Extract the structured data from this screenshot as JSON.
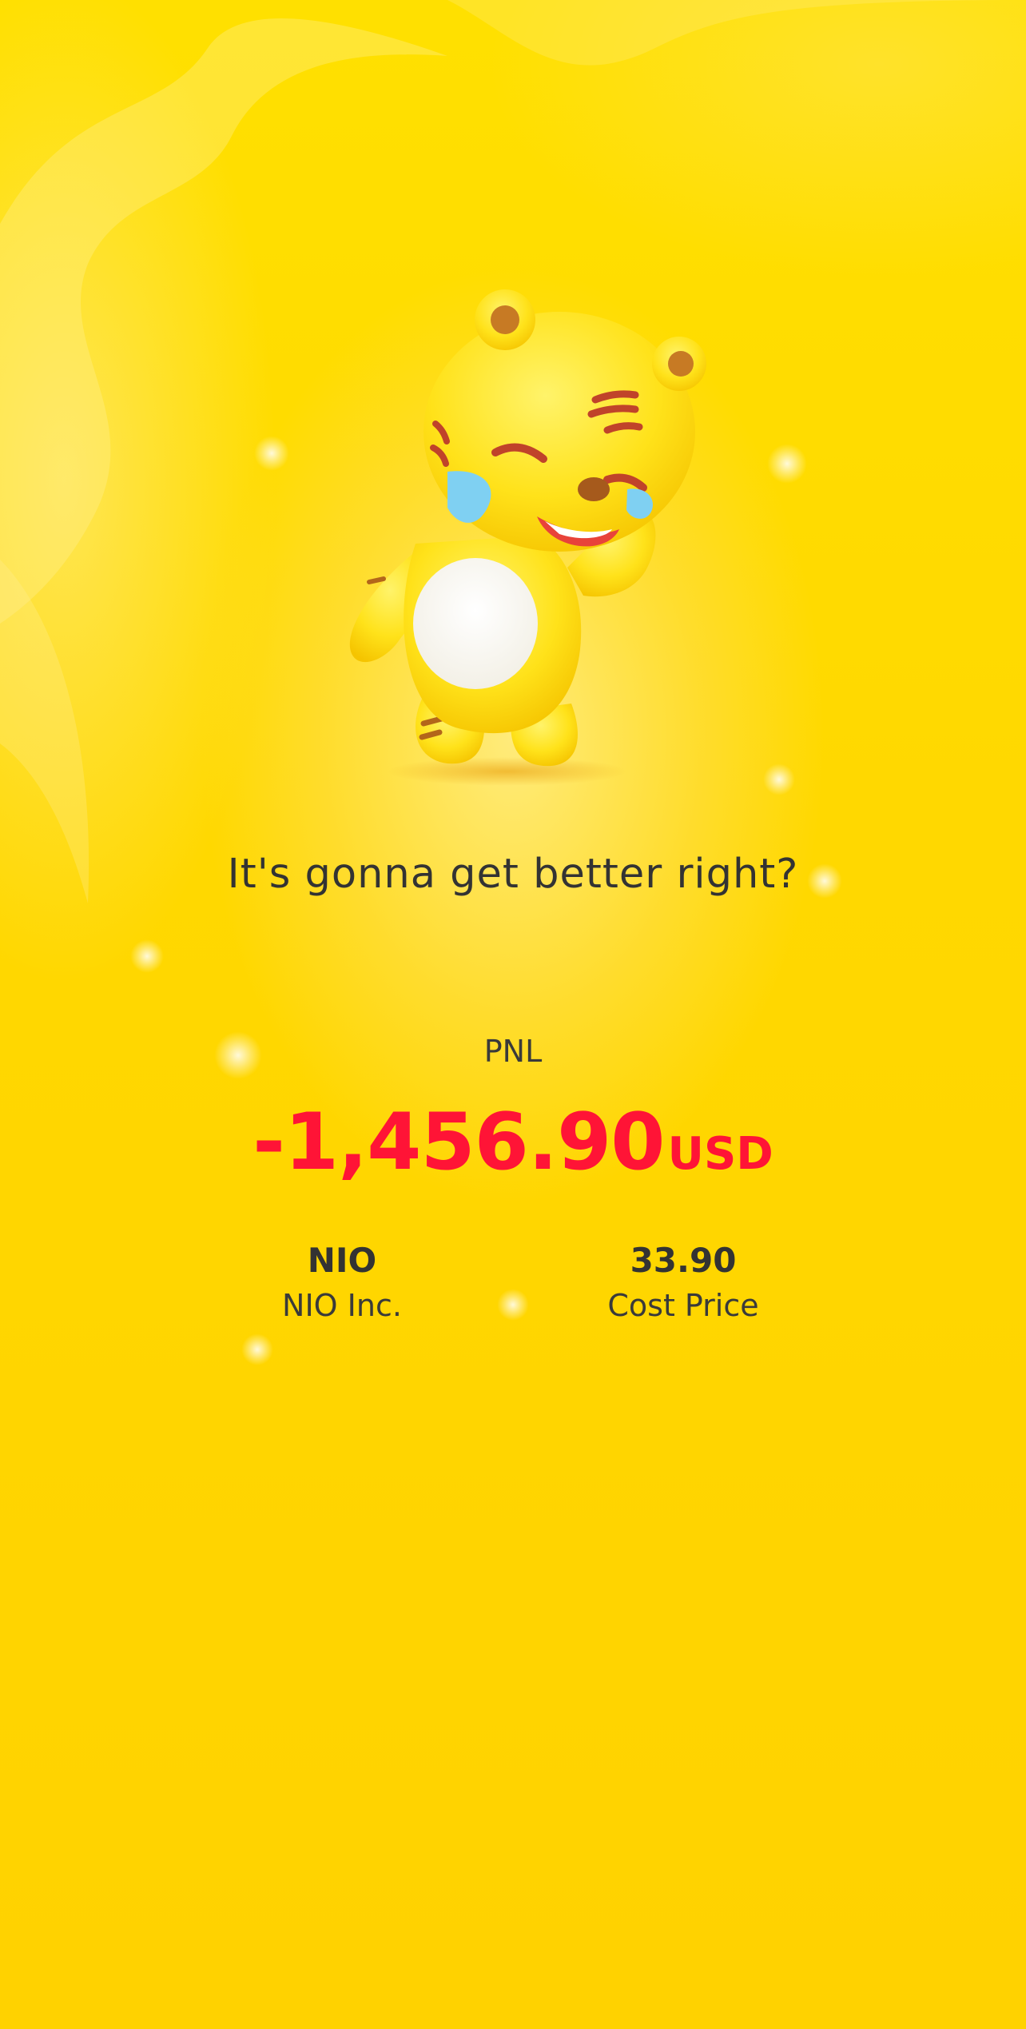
{
  "headline": "It's gonna get better right?",
  "pnl": {
    "label": "PNL",
    "amount": "-1,456.90",
    "currency": "USD",
    "color": "#ff1436"
  },
  "stock": {
    "ticker": "NIO",
    "name": "NIO Inc."
  },
  "cost": {
    "value": "33.90",
    "label": "Cost Price"
  },
  "mascot": {
    "icon": "crying-tiger-mascot"
  },
  "colors": {
    "background": "#ffd400",
    "text": "#333333"
  }
}
